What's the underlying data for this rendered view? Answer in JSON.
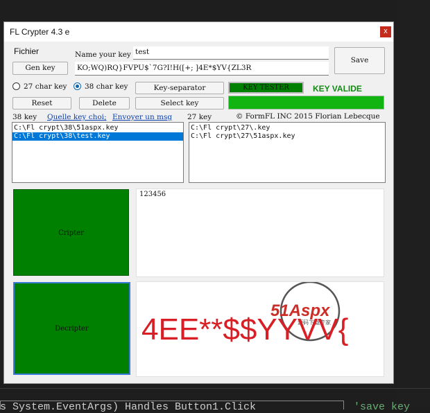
{
  "window": {
    "title": "FL Crypter 4.3 e",
    "close": "x"
  },
  "menu": {
    "fichier": "Fichier"
  },
  "key_form": {
    "name_label": "Name your key",
    "name_value": "test",
    "key_value": "KO;WQ)RQ}FVPU$`7G?I!H([+; ]4E*$YV{ZL3R",
    "save": "Save",
    "gen_key": "Gen key"
  },
  "options": {
    "char27": "27 char key",
    "char38": "38 char key",
    "selected": "38 char key",
    "key_separator": "Key-separator",
    "key_tester": "KEY TESTER",
    "key_valide": "KEY VALIDE",
    "reset": "Reset",
    "delete": "Delete",
    "select_key": "Select key"
  },
  "lists": {
    "left_header": "38 key",
    "link1": "Quelle key choi;",
    "link2": "Envoyer un msg",
    "right_header": "27 key",
    "copyright": "© FormFL INC 2015 Florian Lebecque",
    "left_items": [
      "C:\\Fl crypt\\38\\51aspx.key",
      "C:\\Fl crypt\\38\\test.key"
    ],
    "left_selected": 1,
    "right_items": [
      "C:\\Fl crypt\\27\\.key",
      "C:\\Fl crypt\\27\\51aspx.key"
    ]
  },
  "crypt": {
    "cripter": "Cripter",
    "decripter": "Decripter",
    "input_text": "123456",
    "output_text": "4EE**$$YYVV{"
  },
  "watermark": {
    "logo_text": "51Aspx",
    "sub_text": "源码下载专家"
  },
  "background": {
    "code_line": "s System.EventArgs) Handles Button1.Click",
    "right_code": "'save key"
  },
  "colors": {
    "green": "#008000",
    "bright_green": "#11b411",
    "valide_text": "#118a11",
    "selection": "#0078d7",
    "output_red": "#d91f26"
  }
}
